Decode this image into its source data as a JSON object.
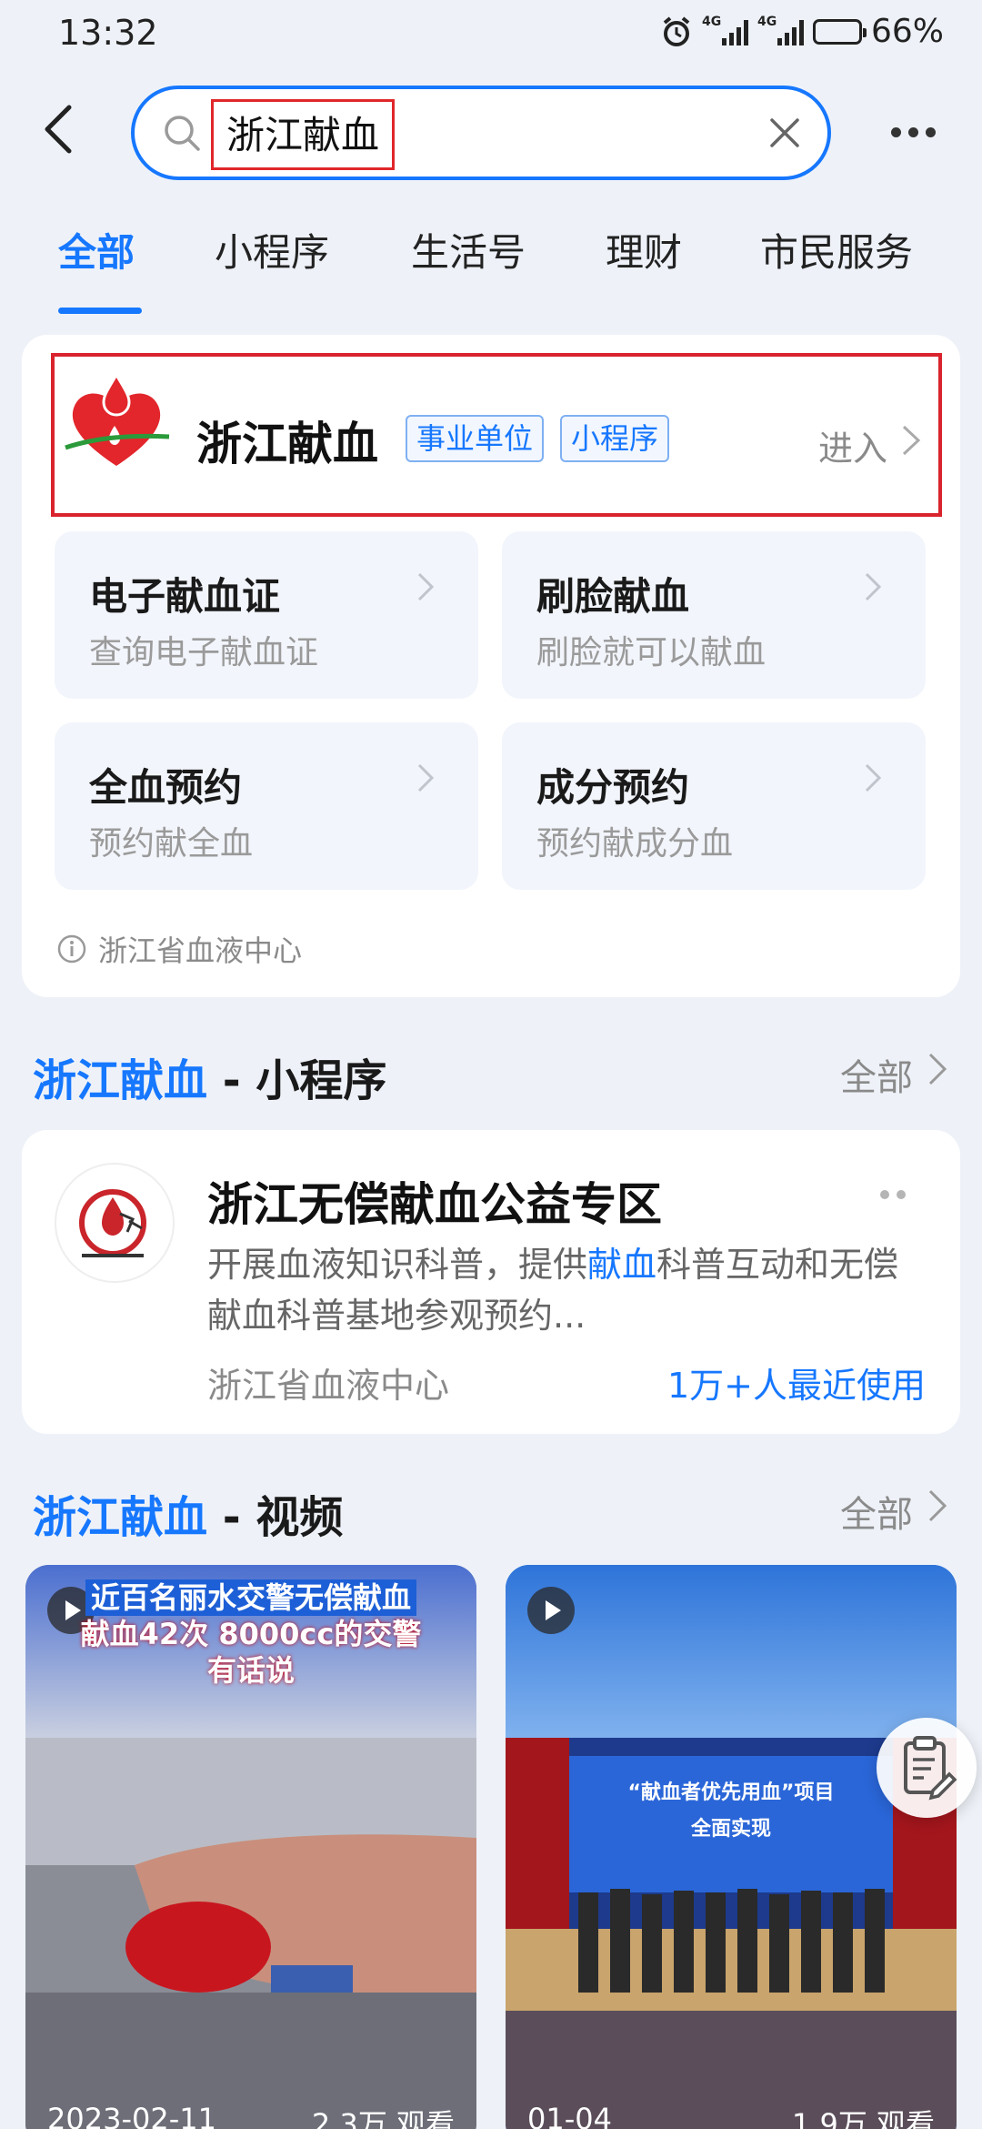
{
  "status_bar": {
    "time": "13:32",
    "battery": "66%",
    "network_1": "4G",
    "network_2": "4G"
  },
  "search": {
    "query": "浙江献血"
  },
  "tabs": [
    {
      "label": "全部",
      "active": true
    },
    {
      "label": "小程序",
      "active": false
    },
    {
      "label": "生活号",
      "active": false
    },
    {
      "label": "理财",
      "active": false
    },
    {
      "label": "市民服务",
      "active": false
    }
  ],
  "top_result": {
    "title": "浙江献血",
    "tags": [
      "事业单位",
      "小程序"
    ],
    "enter_label": "进入",
    "services": [
      {
        "title": "电子献血证",
        "subtitle": "查询电子献血证"
      },
      {
        "title": "刷脸献血",
        "subtitle": "刷脸就可以献血"
      },
      {
        "title": "全血预约",
        "subtitle": "预约献全血"
      },
      {
        "title": "成分预约",
        "subtitle": "预约献成分血"
      }
    ],
    "provider": "浙江省血液中心"
  },
  "mini_program_section": {
    "keyword": "浙江献血",
    "suffix": " - 小程序",
    "all_label": "全部",
    "item": {
      "title": "浙江无偿献血公益专区",
      "desc_before": "开展血液知识科普，提供",
      "desc_highlight": "献血",
      "desc_after": "科普互动和无偿献血科普基地参观预约...",
      "org": "浙江省血液中心",
      "users": "1万+人最近使用"
    }
  },
  "video_section": {
    "keyword": "浙江献血",
    "suffix": " - 视频",
    "all_label": "全部",
    "videos": [
      {
        "caption_line1": "近百名丽水交警无偿献血",
        "caption_line2": "献血42次 8000cc的交警",
        "caption_line3": "有话说",
        "date": "2023-02-11",
        "views": "2.3万 观看"
      },
      {
        "banner": "“献血者优先用血”项目",
        "banner_sub": "全面实现",
        "date": "01-04",
        "views": "1.9万 观看"
      }
    ]
  }
}
